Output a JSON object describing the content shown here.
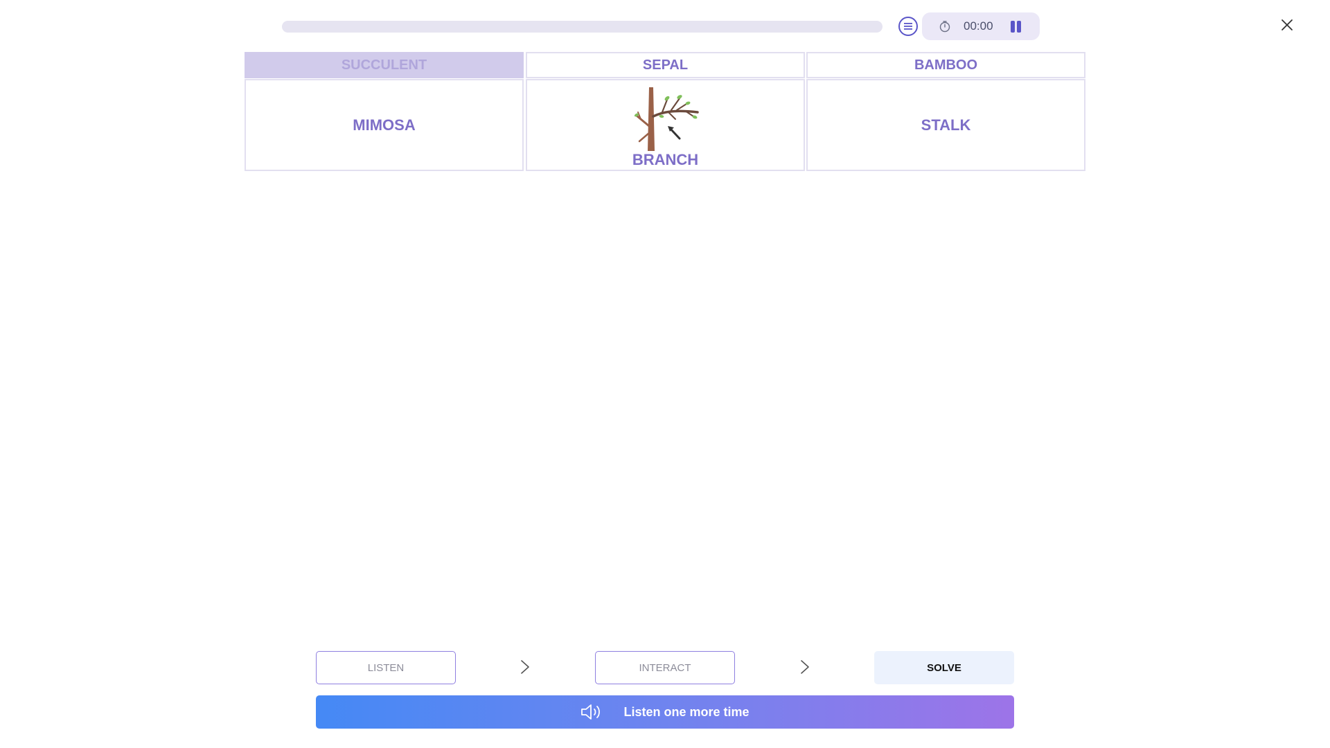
{
  "top_bar": {
    "progress": 0,
    "timer": "00:00",
    "icons": {
      "list": "list-icon",
      "timer": "stopwatch-icon",
      "pause": "pause-icon",
      "close": "close-icon"
    }
  },
  "grid": {
    "headers": [
      "SUCCULENT",
      "SEPAL",
      "BAMBOO"
    ],
    "selected_header": "SUCCULENT",
    "cards": [
      {
        "label": "MIMOSA"
      },
      {
        "label": "BRANCH",
        "image": "tree-branch-image"
      },
      {
        "label": "STALK"
      }
    ]
  },
  "steps": {
    "listen": "LISTEN",
    "interact": "INTERACT",
    "solve": "SOLVE"
  },
  "action": {
    "label": "Listen one more time",
    "icon": "speaker-icon"
  },
  "colors": {
    "accent": "#7d6ec7",
    "selected_bg": "#d1cbeb",
    "gradient_start": "#4589f5",
    "gradient_end": "#9d74e8"
  }
}
